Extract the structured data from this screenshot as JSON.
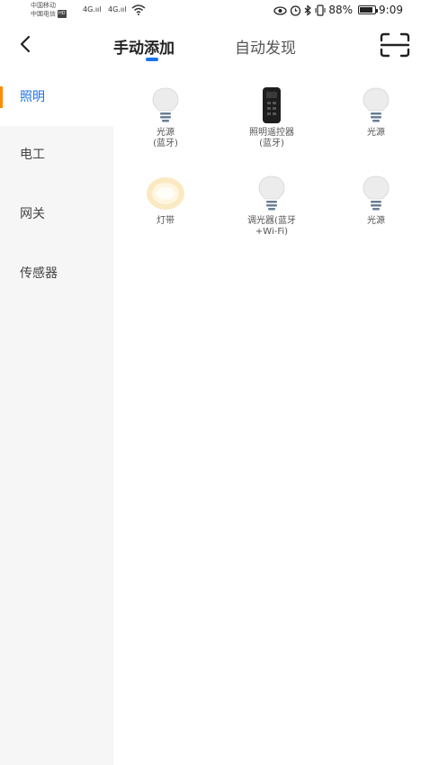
{
  "status_bar": {
    "carrier_1": "中国移动",
    "carrier_2": "中国电信",
    "hd_badge": "HD",
    "signal_1": "4G.ııl",
    "signal_2": "4G.ııl",
    "battery_percent": "88%",
    "battery_level": 0.88,
    "time": "9:09"
  },
  "header": {
    "tabs": [
      {
        "label": "手动添加",
        "active": true
      },
      {
        "label": "自动发现",
        "active": false
      }
    ]
  },
  "sidebar": {
    "items": [
      {
        "label": "照明",
        "active": true
      },
      {
        "label": "电工",
        "active": false
      },
      {
        "label": "网关",
        "active": false
      },
      {
        "label": "传感器",
        "active": false
      }
    ]
  },
  "devices": [
    {
      "label": "光源\n(蓝牙)",
      "icon": "bulb-icon"
    },
    {
      "label": "照明遥控器\n(蓝牙)",
      "icon": "remote-icon"
    },
    {
      "label": "光源",
      "icon": "bulb-icon"
    },
    {
      "label": "灯带",
      "icon": "light-strip-icon"
    },
    {
      "label": "调光器(蓝牙\n+Wi-Fi)",
      "icon": "bulb-icon"
    },
    {
      "label": "光源",
      "icon": "bulb-icon"
    }
  ],
  "colors": {
    "accent": "#1a73e8",
    "active_marker": "#ff8a00",
    "sidebar_bg": "#f6f6f6"
  }
}
